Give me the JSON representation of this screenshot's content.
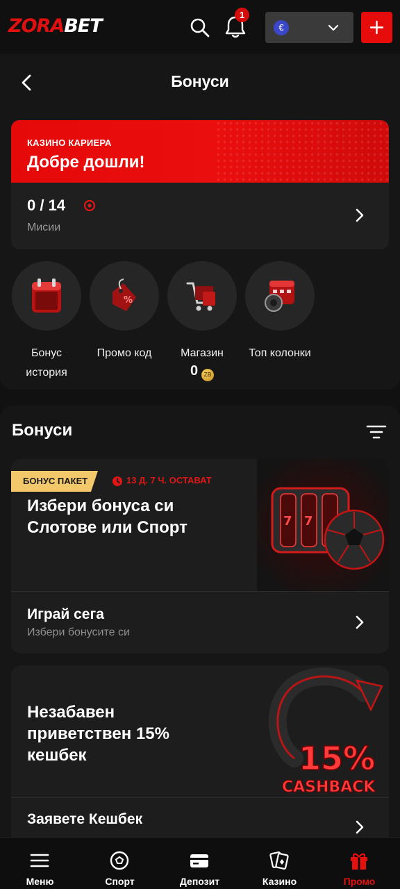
{
  "brand": {
    "part1": "ZORA",
    "part2": "BET"
  },
  "topbar": {
    "notification_count": "1",
    "currency_symbol": "€"
  },
  "page": {
    "title": "Бонуси"
  },
  "career": {
    "kicker": "КАЗИНО КАРИЕРА",
    "title": "Добре дошли!",
    "missions_count": "0 / 14",
    "missions_label": "Мисии"
  },
  "quick_links": [
    {
      "label_line1": "Бонус",
      "label_line2": "история",
      "icon": "calendar-icon"
    },
    {
      "label_line1": "Промо код",
      "icon": "price-tag-icon"
    },
    {
      "label_line1": "Магазин",
      "coins": "0",
      "icon": "shopping-cart-icon"
    },
    {
      "label_line1": "Топ колонки",
      "icon": "top-slots-icon"
    }
  ],
  "bonuses": {
    "section_title": "Бонуси",
    "cards": [
      {
        "badge": "БОНУС ПАКЕТ",
        "timer": "13 Д. 7 Ч. ОСТАВАТ",
        "title_line1": "Избери бонуса си",
        "title_line2": "Слотове или Спорт",
        "cta_title": "Играй сега",
        "cta_subtitle": "Избери бонусите си",
        "art": "slot-reels-and-football"
      },
      {
        "title_line1": "Незабавен",
        "title_line2": "приветствен 15%",
        "title_line3": "кешбек",
        "art_text_top": "15%",
        "art_text_bottom": "CASHBACK",
        "cta_title": "Заявете Кешбек"
      }
    ]
  },
  "bottom_nav": [
    {
      "label": "Меню",
      "icon": "menu-icon"
    },
    {
      "label": "Спорт",
      "icon": "football-icon"
    },
    {
      "label": "Депозит",
      "icon": "card-icon"
    },
    {
      "label": "Казино",
      "icon": "playing-cards-icon"
    },
    {
      "label": "Промо",
      "icon": "gift-icon",
      "active": true
    }
  ],
  "colors": {
    "accent": "#e60c0c",
    "badge_gold": "#f2c86b",
    "background": "#161616"
  }
}
